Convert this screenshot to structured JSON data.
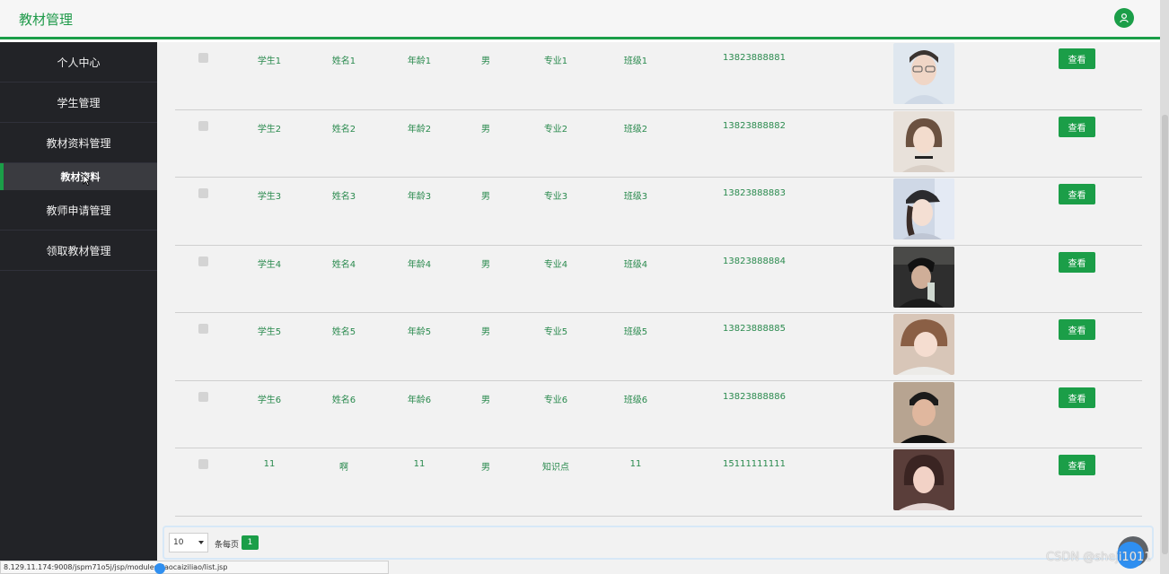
{
  "header": {
    "title": "教材管理",
    "user_icon": "user-icon"
  },
  "sidebar": {
    "items": [
      {
        "label": "个人中心"
      },
      {
        "label": "学生管理"
      },
      {
        "label": "教材资料管理"
      },
      {
        "label": "教师申请管理"
      },
      {
        "label": "领取教材管理"
      }
    ],
    "sub_active": "教材资料"
  },
  "table": {
    "rows": [
      {
        "student_no": "学生1",
        "name": "姓名1",
        "age": "年龄1",
        "gender": "男",
        "major": "专业1",
        "class": "班级1",
        "phone": "13823888881",
        "action": "查看"
      },
      {
        "student_no": "学生2",
        "name": "姓名2",
        "age": "年龄2",
        "gender": "男",
        "major": "专业2",
        "class": "班级2",
        "phone": "13823888882",
        "action": "查看"
      },
      {
        "student_no": "学生3",
        "name": "姓名3",
        "age": "年龄3",
        "gender": "男",
        "major": "专业3",
        "class": "班级3",
        "phone": "13823888883",
        "action": "查看"
      },
      {
        "student_no": "学生4",
        "name": "姓名4",
        "age": "年龄4",
        "gender": "男",
        "major": "专业4",
        "class": "班级4",
        "phone": "13823888884",
        "action": "查看"
      },
      {
        "student_no": "学生5",
        "name": "姓名5",
        "age": "年龄5",
        "gender": "男",
        "major": "专业5",
        "class": "班级5",
        "phone": "13823888885",
        "action": "查看"
      },
      {
        "student_no": "学生6",
        "name": "姓名6",
        "age": "年龄6",
        "gender": "男",
        "major": "专业6",
        "class": "班级6",
        "phone": "13823888886",
        "action": "查看"
      },
      {
        "student_no": "11",
        "name": "啊",
        "age": "11",
        "gender": "男",
        "major": "知识点",
        "class": "11",
        "phone": "15111111111",
        "action": "查看"
      }
    ]
  },
  "pager": {
    "page_size": "10",
    "per_page_label": "条每页",
    "current_page": "1"
  },
  "status_url": "8.129.11.174:9008/jspm71o5j/jsp/modules/jiaocaiziliao/list.jsp",
  "watermark": "CSDN @sheji1011",
  "colors": {
    "accent": "#1b9e48",
    "sidebar_bg": "#222327",
    "text_green": "#2a8a4e"
  }
}
